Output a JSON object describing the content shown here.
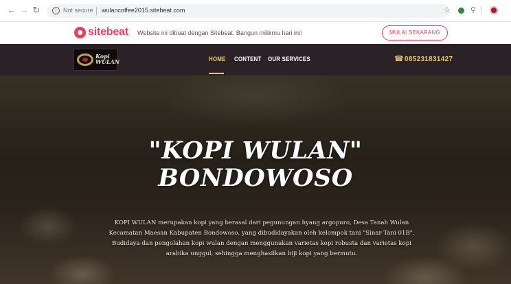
{
  "browser": {
    "security_label": "Not secure",
    "url": "wulancoffee2015.sitebeat.com"
  },
  "promo": {
    "logo_text": "sitebeat",
    "message": "Website ini dibuat dengan Sitebeat. Bangun milikmu hari ini!",
    "cta_label": "MULAI SEKARANG",
    "brand_color": "#ee3e5b"
  },
  "navbar": {
    "brand_text": "Kopi WULAN",
    "menu": [
      {
        "label": "HOME",
        "active": true
      },
      {
        "label": "CONTENT",
        "active": false
      },
      {
        "label": "OUR SERVICES",
        "active": false
      }
    ],
    "phone": "085231831427",
    "accent_color": "#e8c76a"
  },
  "hero": {
    "title_line1": "\"KOPI WULAN\"",
    "title_line2": "BONDOWOSO",
    "description": "KOPI WULAN merupakan kopi yang berasal dari pegunungan hyang argopuro, Desa Tanah Wulan Kecamatan Maesan Kabupaten Bondowoso, yang dibudidayakan oleh kelompok tani \"Sinar Tani 01B\". Budidaya dan pengolahan kopi wulan dengan menggunakan varietas kopi robusta dan varietas kopi arabika unggul, sehingga menghasilkan biji kopi yang bermutu."
  }
}
